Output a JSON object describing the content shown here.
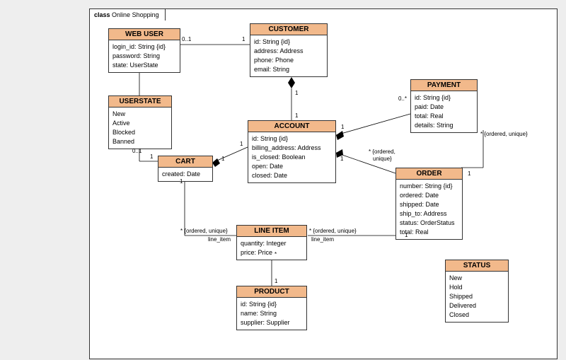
{
  "frame_title_strong": "class",
  "frame_title_rest": "Online Shopping",
  "classes": {
    "web_user": {
      "name": "WEB USER",
      "attrs": [
        "login_id: String {id}",
        "password: String",
        "state: UserState"
      ]
    },
    "customer": {
      "name": "CUSTOMER",
      "attrs": [
        "id: String {id}",
        "address: Address",
        "phone: Phone",
        "email: String"
      ]
    },
    "userstate": {
      "name": "USERSTATE",
      "attrs": [
        "New",
        "Active",
        "Blocked",
        "Banned"
      ]
    },
    "account": {
      "name": "ACCOUNT",
      "attrs": [
        "id: String {id}",
        "billing_address: Address",
        "is_closed: Boolean",
        "open: Date",
        "closed: Date"
      ]
    },
    "payment": {
      "name": "PAYMENT",
      "attrs": [
        "id: String {id}",
        "paid: Date",
        "total: Real",
        "details: String"
      ]
    },
    "cart": {
      "name": "CART",
      "attrs": [
        "created: Date"
      ]
    },
    "order": {
      "name": "ORDER",
      "attrs": [
        "number: String {id}",
        "ordered: Date",
        "shipped: Date",
        "ship_to: Address",
        "status: OrderStatus",
        "total: Real"
      ]
    },
    "line_item": {
      "name": "LINE ITEM",
      "attrs": [
        "quantity: Integer",
        "price: Price"
      ]
    },
    "product": {
      "name": "PRODUCT",
      "attrs": [
        "id: String {id}",
        "name: String",
        "supplier: Supplier"
      ]
    },
    "status": {
      "name": "STATUS",
      "attrs": [
        "New",
        "Hold",
        "Shipped",
        "Delivered",
        "Closed"
      ]
    }
  },
  "labels": {
    "m01": "0..1",
    "m1": "1",
    "m0star": "0..*",
    "star": "*",
    "ordered_unique": "{ordered, unique}",
    "ordered_unique_star_a": "* {ordered,",
    "ordered_unique_star_b": "unique}",
    "star_ordered_unique": "* {ordered, unique}",
    "line_item_role": "line_item"
  }
}
